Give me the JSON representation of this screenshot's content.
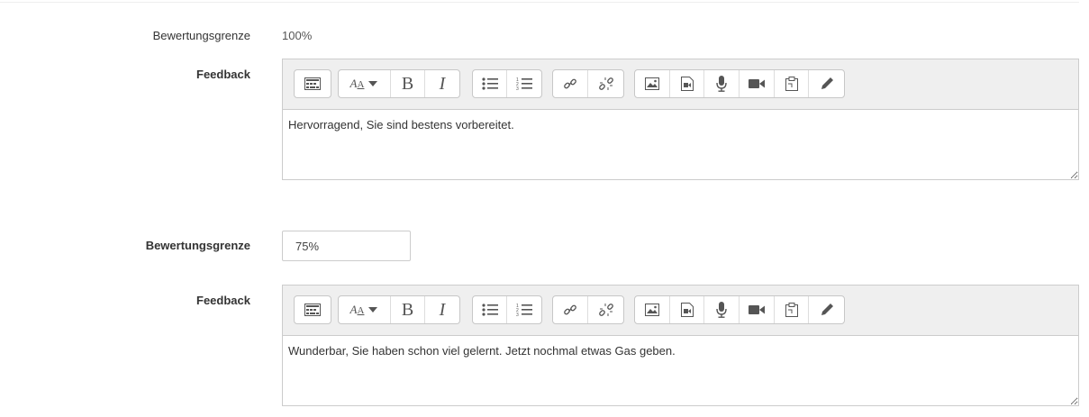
{
  "sections": [
    {
      "grade_label": "Bewertungsgrenze",
      "grade_value": "100%",
      "feedback_label": "Feedback",
      "feedback_text": "Hervorragend, Sie sind bestens vorbereitet."
    },
    {
      "grade_label": "Bewertungsgrenze",
      "grade_value": "75%",
      "feedback_label": "Feedback",
      "feedback_text": "Wunderbar, Sie haben schon viel gelernt. Jetzt nochmal etwas Gas geben."
    }
  ],
  "toolbar": {
    "font_style_label": "A",
    "bold_label": "B",
    "italic_label": "I",
    "icons": [
      "toolbar-toggle-icon",
      "font-style-icon",
      "bold-icon",
      "italic-icon",
      "unordered-list-icon",
      "ordered-list-icon",
      "link-icon",
      "unlink-icon",
      "image-icon",
      "media-icon",
      "record-audio-icon",
      "record-video-icon",
      "manage-files-icon",
      "draw-icon"
    ]
  }
}
